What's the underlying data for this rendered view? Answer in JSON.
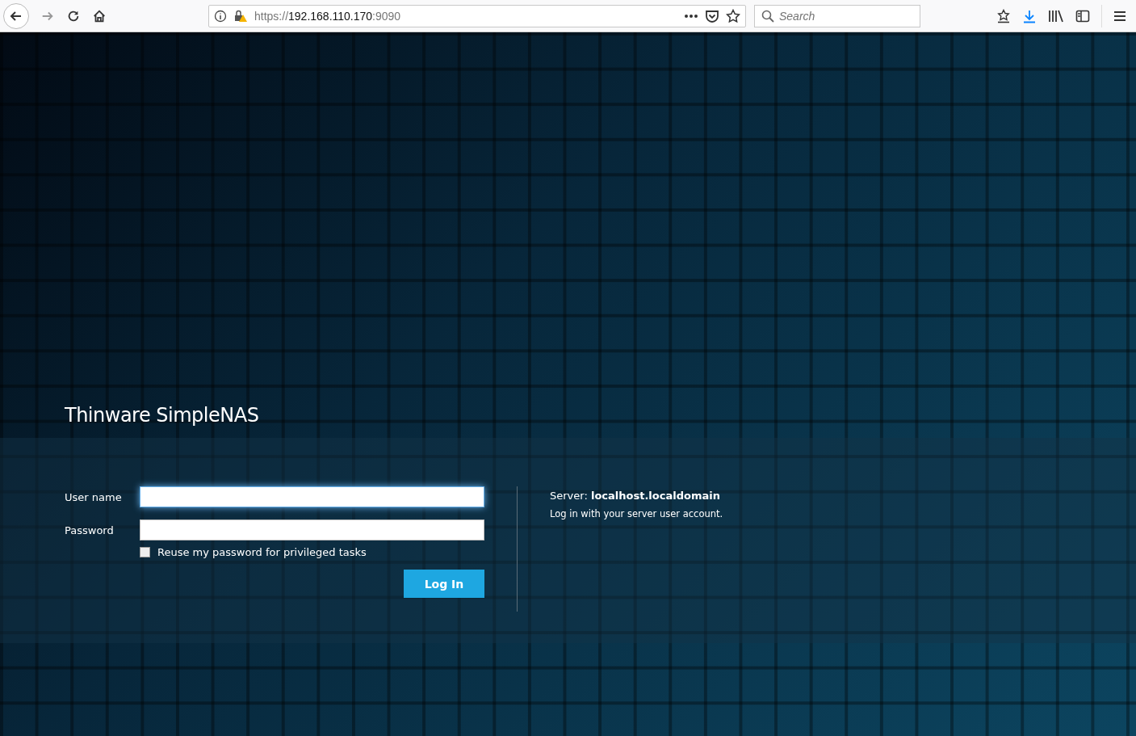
{
  "browser": {
    "url": {
      "scheme": "https://",
      "host": "192.168.110.170",
      "port": ":9090"
    },
    "search": {
      "placeholder": "Search"
    }
  },
  "brand": {
    "title": "Thinware SimpleNAS"
  },
  "login": {
    "fields": [
      {
        "label": "User name",
        "focused": true
      },
      {
        "label": "Password",
        "focused": false
      }
    ],
    "reuse_password": {
      "label": "Reuse my password for privileged tasks",
      "checked": false
    },
    "button": "Log In"
  },
  "info": {
    "server": "Server: **localhost.localdomain**",
    "hint": "Log in with your server user account."
  }
}
